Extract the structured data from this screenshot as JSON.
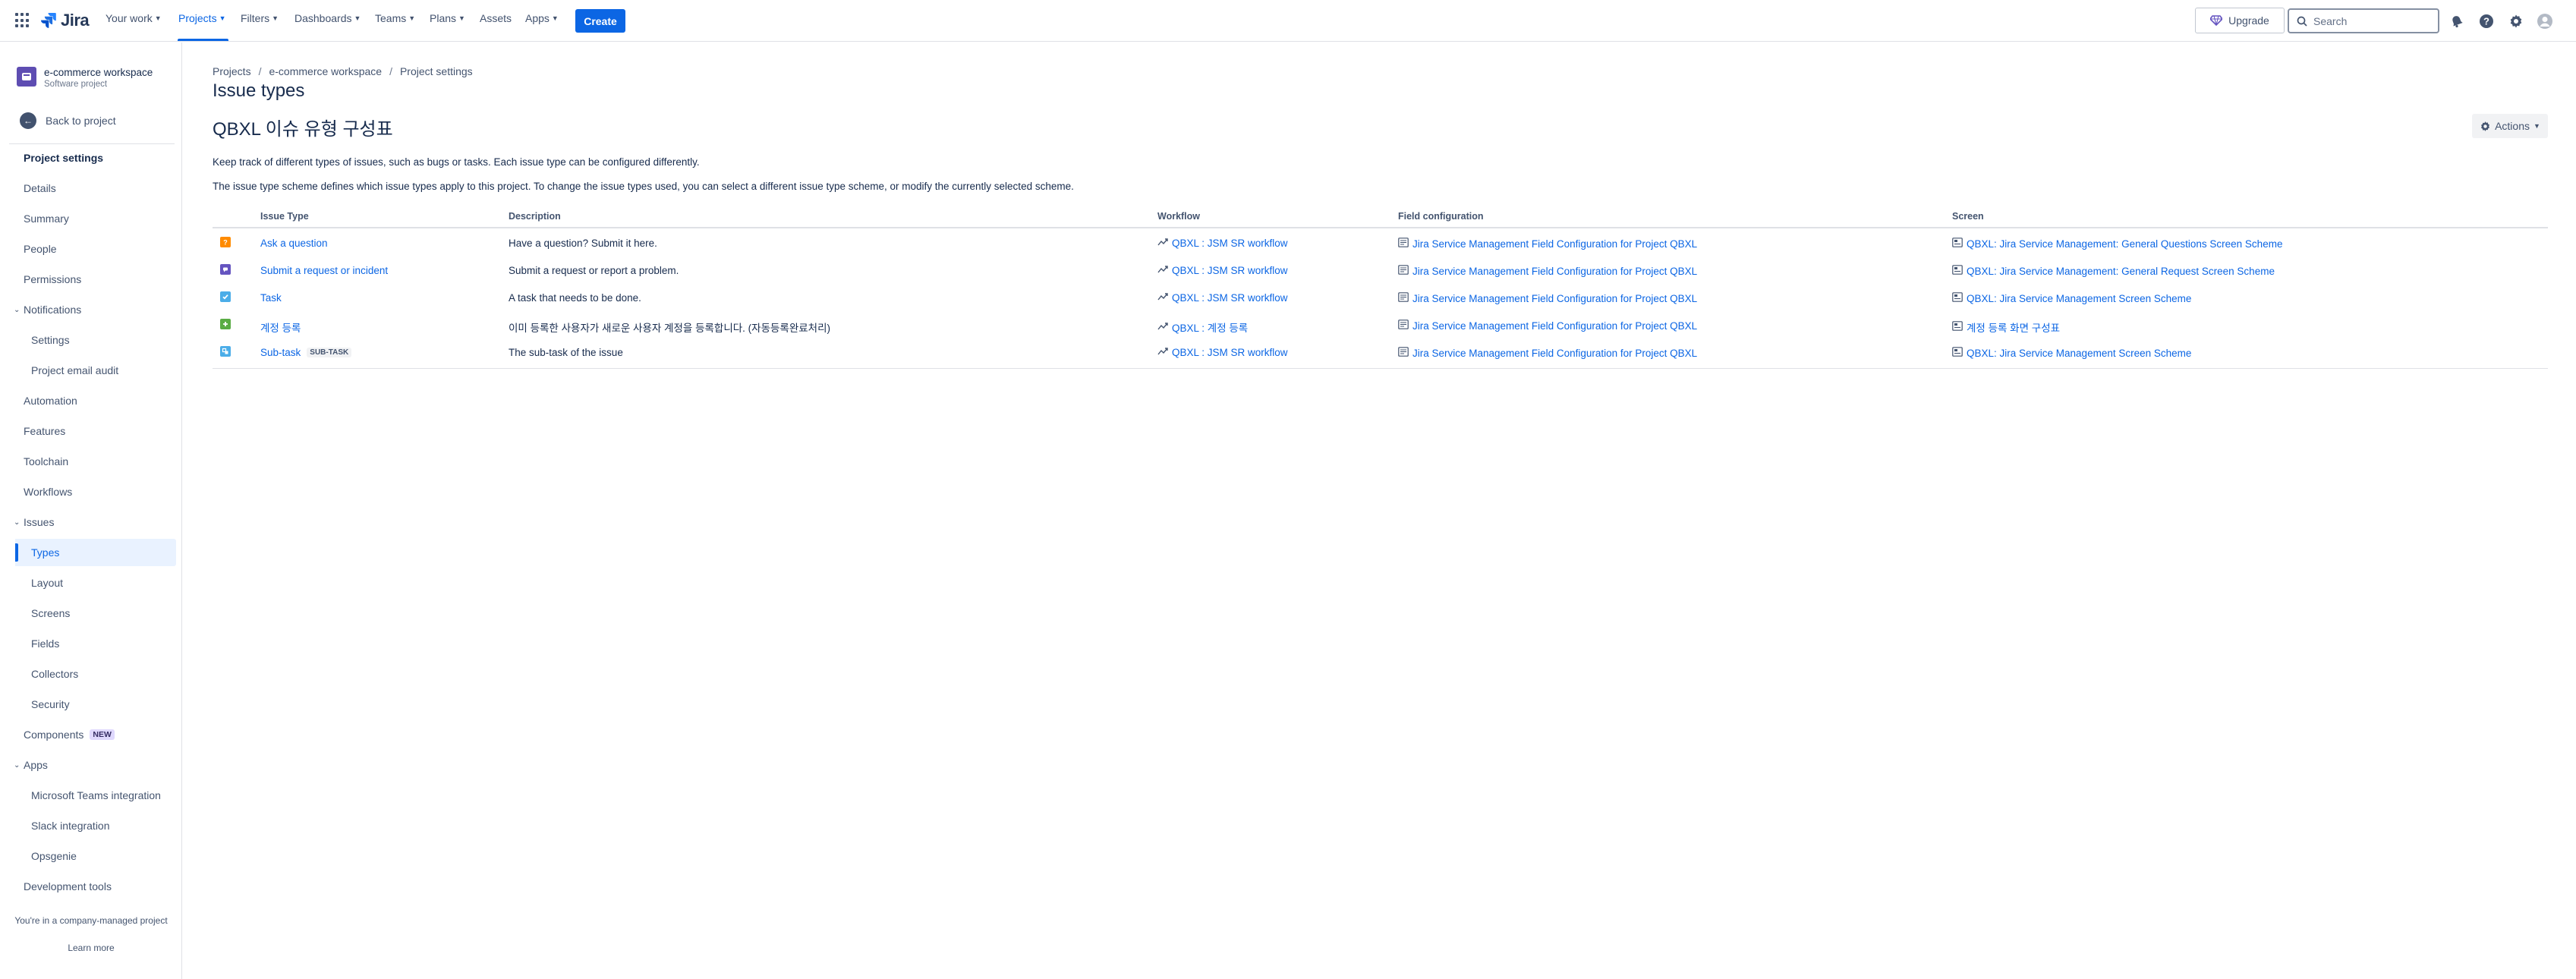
{
  "topnav": {
    "product": "Jira",
    "items": [
      {
        "label": "Your work",
        "dropdown": true
      },
      {
        "label": "Projects",
        "dropdown": true,
        "active": true
      },
      {
        "label": "Filters",
        "dropdown": true
      },
      {
        "label": "Dashboards",
        "dropdown": true
      },
      {
        "label": "Teams",
        "dropdown": true
      },
      {
        "label": "Plans",
        "dropdown": true
      },
      {
        "label": "Assets",
        "dropdown": false
      },
      {
        "label": "Apps",
        "dropdown": true
      }
    ],
    "create_label": "Create",
    "upgrade_label": "Upgrade",
    "search_placeholder": "Search",
    "accent": "#0c66e4"
  },
  "sidebar": {
    "project_name": "e-commerce workspace",
    "project_type": "Software project",
    "back_label": "Back to project",
    "section_title": "Project settings",
    "items": [
      {
        "label": "Details",
        "level": "top"
      },
      {
        "label": "Summary",
        "level": "top"
      },
      {
        "label": "People",
        "level": "top"
      },
      {
        "label": "Permissions",
        "level": "top"
      },
      {
        "label": "Notifications",
        "level": "group"
      },
      {
        "label": "Settings",
        "level": "sub"
      },
      {
        "label": "Project email audit",
        "level": "sub"
      },
      {
        "label": "Automation",
        "level": "top"
      },
      {
        "label": "Features",
        "level": "top"
      },
      {
        "label": "Toolchain",
        "level": "top"
      },
      {
        "label": "Workflows",
        "level": "top"
      },
      {
        "label": "Issues",
        "level": "group"
      },
      {
        "label": "Types",
        "level": "sub",
        "selected": true
      },
      {
        "label": "Layout",
        "level": "sub"
      },
      {
        "label": "Screens",
        "level": "sub"
      },
      {
        "label": "Fields",
        "level": "sub"
      },
      {
        "label": "Collectors",
        "level": "sub"
      },
      {
        "label": "Security",
        "level": "sub"
      },
      {
        "label": "Components",
        "level": "top",
        "badge": "NEW"
      },
      {
        "label": "Apps",
        "level": "group"
      },
      {
        "label": "Microsoft Teams integration",
        "level": "sub"
      },
      {
        "label": "Slack integration",
        "level": "sub"
      },
      {
        "label": "Opsgenie",
        "level": "sub"
      },
      {
        "label": "Development tools",
        "level": "top"
      }
    ],
    "footer_text": "You're in a company-managed project",
    "footer_link": "Learn more"
  },
  "main": {
    "breadcrumb": [
      "Projects",
      "e-commerce workspace",
      "Project settings"
    ],
    "page_title": "Issue types",
    "scheme_title": "QBXL 이슈 유형 구성표",
    "actions_label": "Actions",
    "description_1": "Keep track of different types of issues, such as bugs or tasks. Each issue type can be configured differently.",
    "description_2": "The issue type scheme defines which issue types apply to this project. To change the issue types used, you can select a different issue type scheme, or modify the currently selected scheme.",
    "table": {
      "headers": {
        "issue_type": "Issue Type",
        "description": "Description",
        "workflow": "Workflow",
        "field_configuration": "Field configuration",
        "screen": "Screen"
      },
      "rows": [
        {
          "icon": "question-icon",
          "icon_color": "#ff8b00",
          "issue_type": "Ask a question",
          "lozenge": "",
          "description": "Have a question? Submit it here.",
          "workflow": "QBXL : JSM SR workflow",
          "field_configuration": "Jira Service Management Field Configuration for Project QBXL",
          "screen": "QBXL: Jira Service Management: General Questions Screen Scheme"
        },
        {
          "icon": "request-icon",
          "icon_color": "#6554c0",
          "issue_type": "Submit a request or incident",
          "lozenge": "",
          "description": "Submit a request or report a problem.",
          "workflow": "QBXL : JSM SR workflow",
          "field_configuration": "Jira Service Management Field Configuration for Project QBXL",
          "screen": "QBXL: Jira Service Management: General Request Screen Scheme"
        },
        {
          "icon": "task-icon",
          "icon_color": "#4bade8",
          "issue_type": "Task",
          "lozenge": "",
          "description": "A task that needs to be done.",
          "workflow": "QBXL : JSM SR workflow",
          "field_configuration": "Jira Service Management Field Configuration for Project QBXL",
          "screen": "QBXL: Jira Service Management Screen Scheme"
        },
        {
          "icon": "new-feature-icon",
          "icon_color": "#5aac44",
          "issue_type": "계정 등록",
          "lozenge": "",
          "description": "이미 등록한 사용자가 새로운 사용자 계정을 등록합니다. (자동등록완료처리)",
          "workflow": "QBXL : 계정 등록",
          "field_configuration": "Jira Service Management Field Configuration for Project QBXL",
          "screen": "계정 등록 화면 구성표"
        },
        {
          "icon": "subtask-icon",
          "icon_color": "#4bade8",
          "issue_type": "Sub-task",
          "lozenge": "SUB-TASK",
          "description": "The sub-task of the issue",
          "workflow": "QBXL : JSM SR workflow",
          "field_configuration": "Jira Service Management Field Configuration for Project QBXL",
          "screen": "QBXL: Jira Service Management Screen Scheme"
        }
      ]
    }
  }
}
